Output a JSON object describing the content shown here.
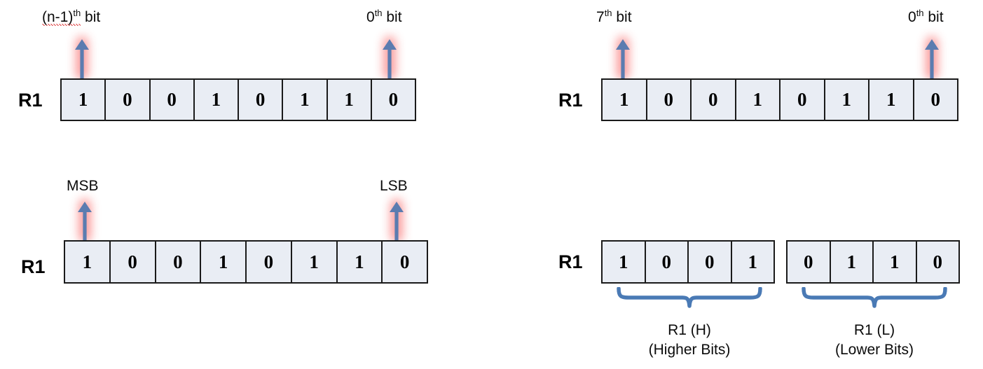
{
  "figure": {
    "background_color": "#ffffff",
    "cell_fill": "#e9edf4",
    "cell_border": "#1a1a1a",
    "arrow_color": "#5b7cb0",
    "arrow_glow_color": "#f98d8d",
    "brace_color": "#4a7ab5"
  },
  "panels": {
    "top_left": {
      "register_label": "R1",
      "bits": [
        "1",
        "0",
        "0",
        "1",
        "0",
        "1",
        "1",
        "0"
      ],
      "left_callout": {
        "text_before": "(n-1)",
        "superscript": "th",
        "text_after": " bit",
        "full_text": "(n-1)th bit",
        "misspelled": true
      },
      "right_callout": {
        "text_before": "0",
        "superscript": "th",
        "text_after": " bit",
        "full_text": "0th bit",
        "misspelled": false
      }
    },
    "bottom_left": {
      "register_label": "R1",
      "bits": [
        "1",
        "0",
        "0",
        "1",
        "0",
        "1",
        "1",
        "0"
      ],
      "left_callout": {
        "full_text": "MSB"
      },
      "right_callout": {
        "full_text": "LSB"
      }
    },
    "top_right": {
      "register_label": "R1",
      "bits": [
        "1",
        "0",
        "0",
        "1",
        "0",
        "1",
        "1",
        "0"
      ],
      "left_callout": {
        "text_before": "7",
        "superscript": "th",
        "text_after": " bit",
        "full_text": "7th bit",
        "misspelled": false
      },
      "right_callout": {
        "text_before": "0",
        "superscript": "th",
        "text_after": " bit",
        "full_text": "0th bit",
        "misspelled": false
      }
    },
    "bottom_right": {
      "register_label": "R1",
      "high_bits": [
        "1",
        "0",
        "0",
        "1"
      ],
      "low_bits": [
        "0",
        "1",
        "1",
        "0"
      ],
      "high_group": {
        "name": "R1 (H)",
        "description": "(Higher Bits)"
      },
      "low_group": {
        "name": "R1 (L)",
        "description": "(Lower Bits)"
      }
    }
  }
}
